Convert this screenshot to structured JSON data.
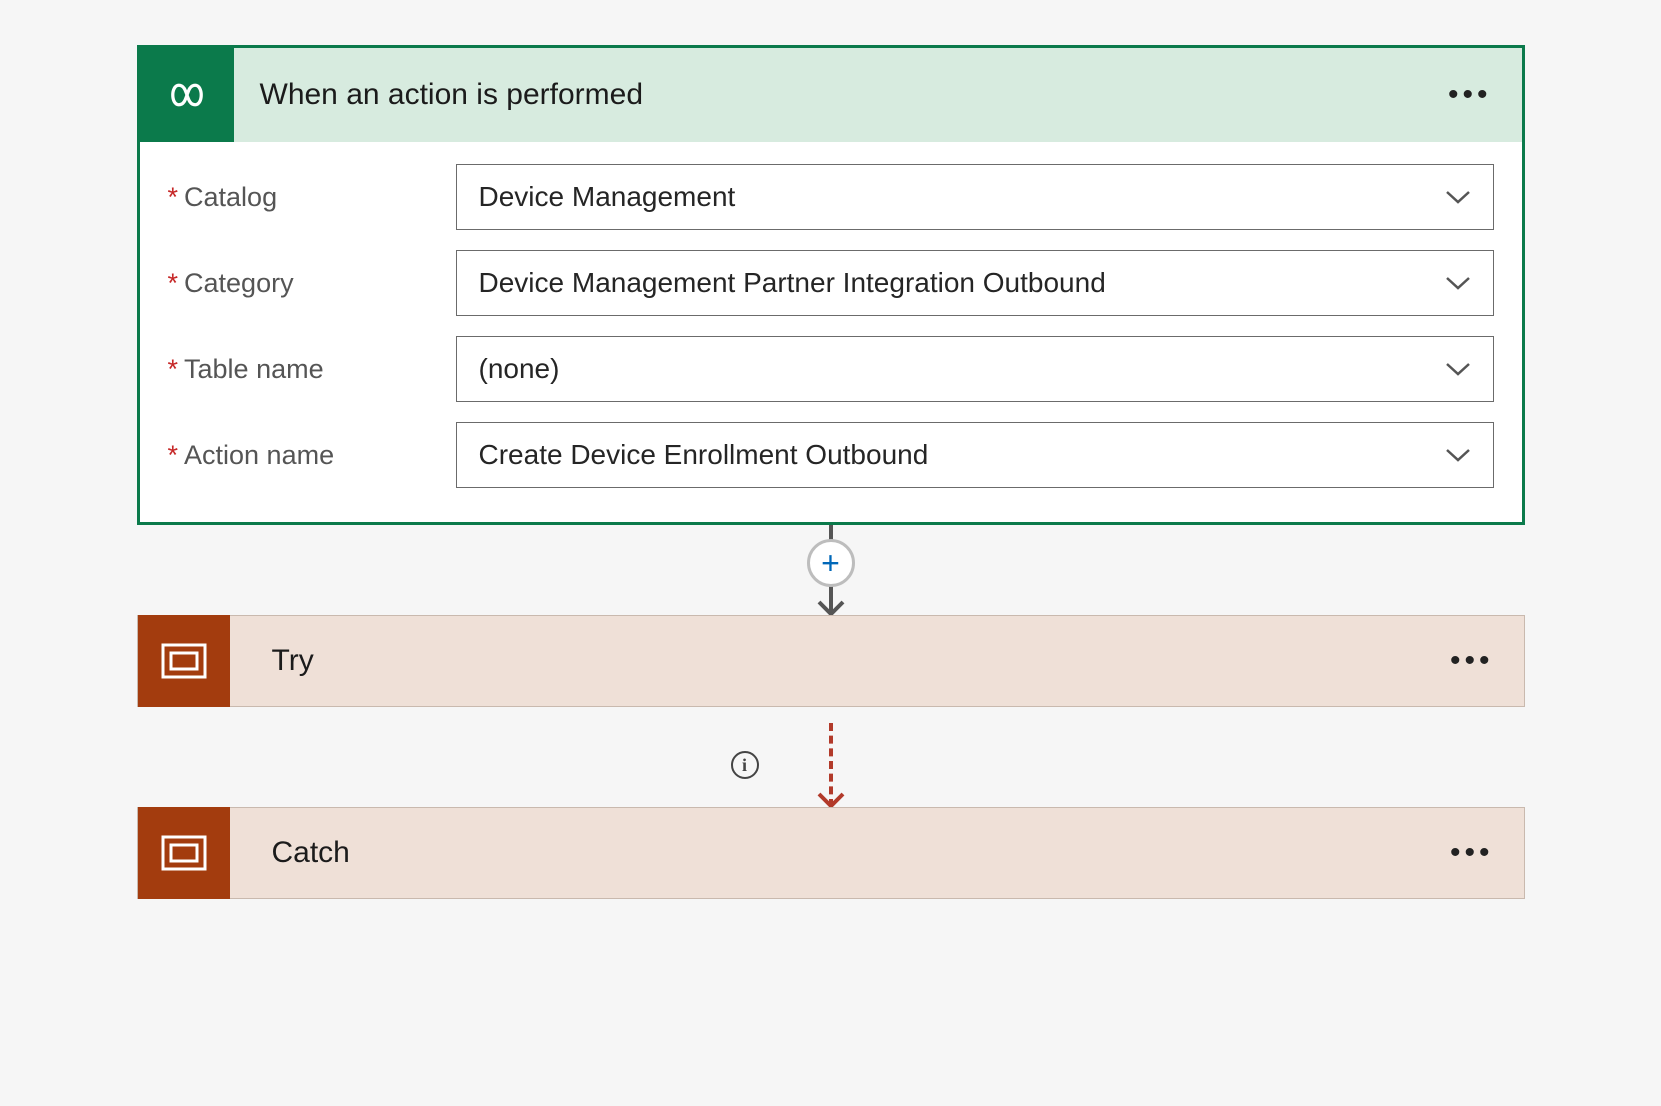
{
  "trigger": {
    "title": "When an action is performed",
    "fields": [
      {
        "label": "Catalog",
        "value": "Device Management"
      },
      {
        "label": "Category",
        "value": "Device Management Partner Integration Outbound"
      },
      {
        "label": "Table name",
        "value": "(none)"
      },
      {
        "label": "Action name",
        "value": "Create Device Enrollment Outbound"
      }
    ]
  },
  "actions": {
    "try": {
      "title": "Try"
    },
    "catch": {
      "title": "Catch"
    }
  },
  "colors": {
    "trigger_accent": "#0b7a4b",
    "trigger_header_bg": "#d7ebdf",
    "action_accent": "#a33c0e",
    "action_bg": "#efe0d7",
    "dashed_connector": "#b23a2a"
  }
}
